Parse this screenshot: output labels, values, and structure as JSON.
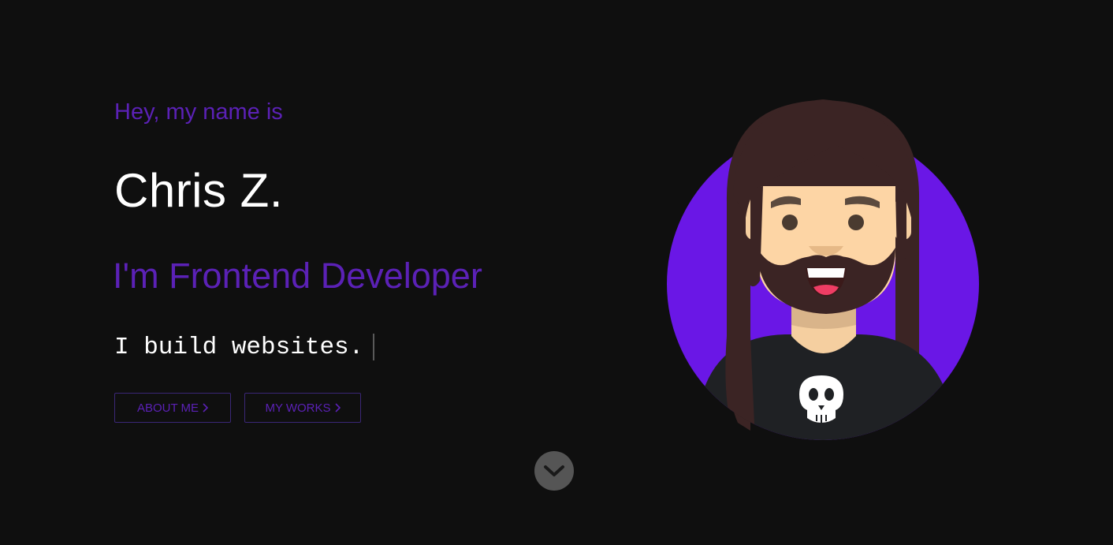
{
  "hero": {
    "greeting": "Hey, my name is",
    "name": "Chris Z.",
    "role": "I'm Frontend Developer",
    "typed_text": "I build websites."
  },
  "buttons": {
    "about_label": "ABOUT ME",
    "works_label": "MY WORKS"
  },
  "icons": {
    "button_chevron": "chevron-right-icon",
    "scroll_down": "chevron-down-icon",
    "avatar": "avatar-illustration",
    "shirt_print": "skull-icon"
  },
  "colors": {
    "background": "#0f0f0f",
    "accent": "#5b21b6",
    "avatar_circle": "#6a17e6",
    "text": "#ffffff",
    "scroll_button": "#555555"
  }
}
